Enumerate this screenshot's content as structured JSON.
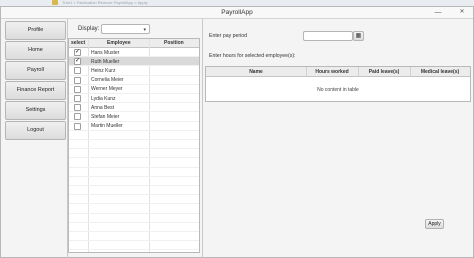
{
  "outer": {
    "title": "Tree1 > Fabrication Remove PayrollApp > Apply"
  },
  "window": {
    "title": "PayrollApp",
    "minimize": "—",
    "close": "✕"
  },
  "sidebar": {
    "items": [
      {
        "label": "Profile"
      },
      {
        "label": "Home"
      },
      {
        "label": "Payroll"
      },
      {
        "label": "Finance Report"
      },
      {
        "label": "Settings"
      },
      {
        "label": "Logout"
      }
    ]
  },
  "display": {
    "label": "Display:",
    "value": ""
  },
  "employee_table": {
    "columns": [
      "select",
      "Employee",
      "Position"
    ],
    "rows": [
      {
        "checked": true,
        "name": "Hans Muster",
        "position": ""
      },
      {
        "checked": true,
        "name": "Ruth Mueller",
        "position": "",
        "selected": true
      },
      {
        "checked": false,
        "name": "Heinz Kurz",
        "position": ""
      },
      {
        "checked": false,
        "name": "Cornelia Meier",
        "position": ""
      },
      {
        "checked": false,
        "name": "Werner Meyer",
        "position": ""
      },
      {
        "checked": false,
        "name": "Lydia Kunz",
        "position": ""
      },
      {
        "checked": false,
        "name": "Anna Best",
        "position": ""
      },
      {
        "checked": false,
        "name": "Stefan Meier",
        "position": ""
      },
      {
        "checked": false,
        "name": "Martin Mueller",
        "position": ""
      }
    ]
  },
  "pay_period": {
    "label": "Enter pay period",
    "value": "",
    "calendar_icon": "calendar-icon"
  },
  "hours": {
    "label": "Enter hours for selected employee(s):",
    "columns": [
      "Name",
      "Hours worked",
      "Paid leave(s)",
      "Medical leave(s)"
    ],
    "empty_text": "No content in table"
  },
  "apply_label": "Apply"
}
